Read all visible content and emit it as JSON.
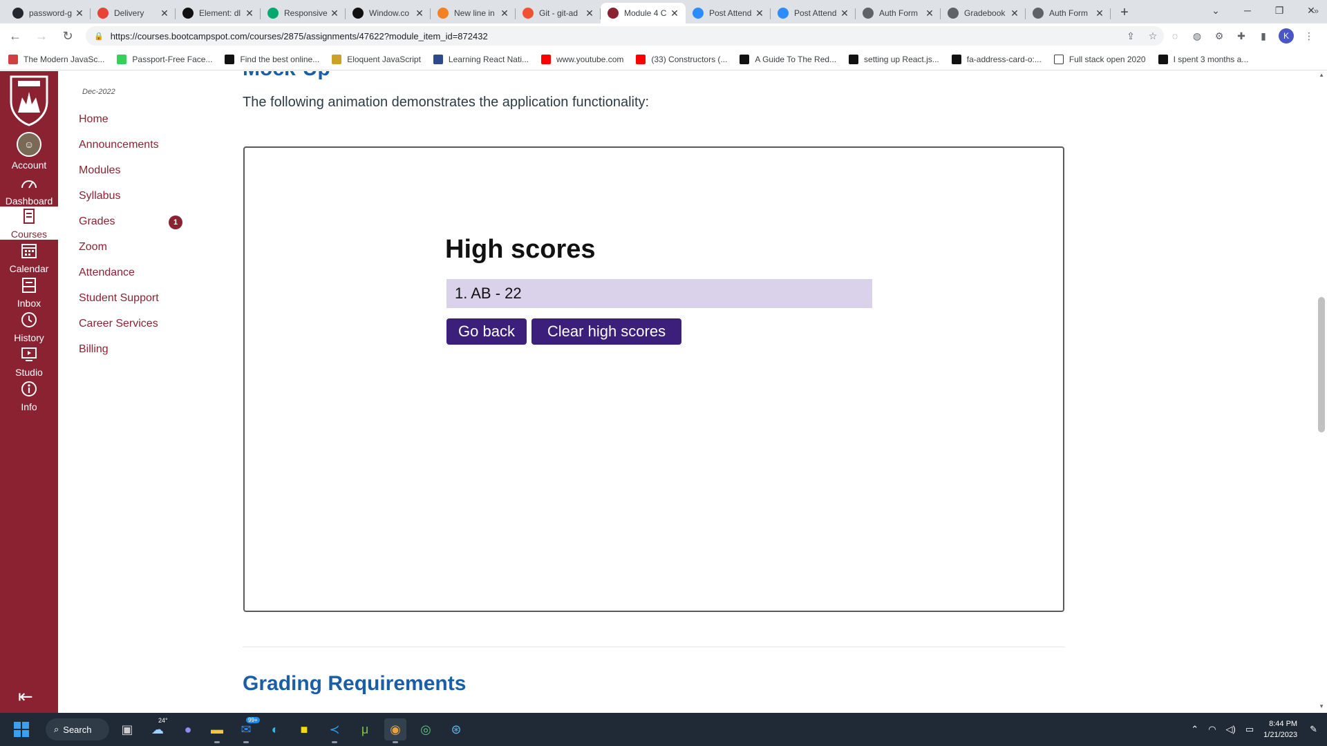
{
  "browser": {
    "tabs": [
      {
        "title": "password-g",
        "favicon": "github-icon",
        "color": "#24292f"
      },
      {
        "title": "Delivery",
        "favicon": "gmail-icon",
        "color": "#ea4335"
      },
      {
        "title": "Element: dl",
        "favicon": "mdn-icon",
        "color": "#111111"
      },
      {
        "title": "Responsive",
        "favicon": "w3schools-icon",
        "color": "#04aa6d"
      },
      {
        "title": "Window.co",
        "favicon": "mdn-icon",
        "color": "#111111"
      },
      {
        "title": "New line in",
        "favicon": "stackoverflow-icon",
        "color": "#f48024"
      },
      {
        "title": "Git - git-ad",
        "favicon": "git-icon",
        "color": "#f05133"
      },
      {
        "title": "Module 4 C",
        "favicon": "shield-icon",
        "color": "#8b2232"
      },
      {
        "title": "Post Attend",
        "favicon": "zoom-icon",
        "color": "#2d8cff"
      },
      {
        "title": "Post Attend",
        "favicon": "zoom-icon",
        "color": "#2d8cff"
      },
      {
        "title": "Auth Form",
        "favicon": "globe-icon",
        "color": "#5f6368"
      },
      {
        "title": "Gradebook",
        "favicon": "globe-icon",
        "color": "#5f6368"
      },
      {
        "title": "Auth Form",
        "favicon": "globe-icon",
        "color": "#5f6368"
      }
    ],
    "active_tab_index": 7,
    "url": "https://courses.bootcampspot.com/courses/2875/assignments/47622?module_item_id=872432",
    "profile_initial": "K",
    "bookmarks": [
      {
        "label": "The Modern JavaSc...",
        "icon": "js-info-icon",
        "color": "#d04040"
      },
      {
        "label": "Passport-Free Face...",
        "icon": "passport-icon",
        "color": "#34d058"
      },
      {
        "label": "Find the best online...",
        "icon": "hackr-icon",
        "color": "#111111"
      },
      {
        "label": "Eloquent JavaScript",
        "icon": "ejs-icon",
        "color": "#c9a227"
      },
      {
        "label": "Learning React Nati...",
        "icon": "book-icon",
        "color": "#2b4a8b"
      },
      {
        "label": "www.youtube.com",
        "icon": "youtube-icon",
        "color": "#ff0000"
      },
      {
        "label": "(33) Constructors (...",
        "icon": "youtube-icon",
        "color": "#ff0000"
      },
      {
        "label": "A Guide To The Red...",
        "icon": "dev-icon",
        "color": "#111111"
      },
      {
        "label": "setting up React.js...",
        "icon": "medium-icon",
        "color": "#111111"
      },
      {
        "label": "fa-address-card-o:...",
        "icon": "flag-icon",
        "color": "#111111"
      },
      {
        "label": "Full stack open 2020",
        "icon": "page-icon",
        "color": "#ffffff"
      },
      {
        "label": "I spent 3 months a...",
        "icon": "dev-icon",
        "color": "#111111"
      }
    ]
  },
  "global_nav": {
    "items": [
      {
        "label": "Account",
        "icon": "avatar-icon"
      },
      {
        "label": "Dashboard",
        "icon": "dashboard-icon"
      },
      {
        "label": "Courses",
        "icon": "courses-icon"
      },
      {
        "label": "Calendar",
        "icon": "calendar-icon"
      },
      {
        "label": "Inbox",
        "icon": "inbox-icon"
      },
      {
        "label": "History",
        "icon": "history-icon"
      },
      {
        "label": "Studio",
        "icon": "studio-icon"
      },
      {
        "label": "Info",
        "icon": "info-icon"
      }
    ],
    "active": "Courses",
    "brand_color": "#8b2232"
  },
  "course_nav": {
    "term": "Dec-2022",
    "links": [
      "Home",
      "Announcements",
      "Modules",
      "Syllabus",
      "Grades",
      "Zoom",
      "Attendance",
      "Student Support",
      "Career Services",
      "Billing"
    ],
    "grades_badge": "1"
  },
  "main": {
    "mockup_heading": "Mock-Up",
    "intro": "The following animation demonstrates the application functionality:",
    "demo": {
      "title": "High scores",
      "scores": [
        "1. AB - 22"
      ],
      "go_back_label": "Go back",
      "clear_label": "Clear high scores",
      "button_color": "#3c1f7b",
      "list_bg": "#d9d2ea"
    },
    "grading_heading": "Grading Requirements"
  },
  "taskbar": {
    "search_label": "Search",
    "weather_temp": "24°",
    "mail_badge": "99+",
    "time": "8:44 PM",
    "date": "1/21/2023"
  }
}
